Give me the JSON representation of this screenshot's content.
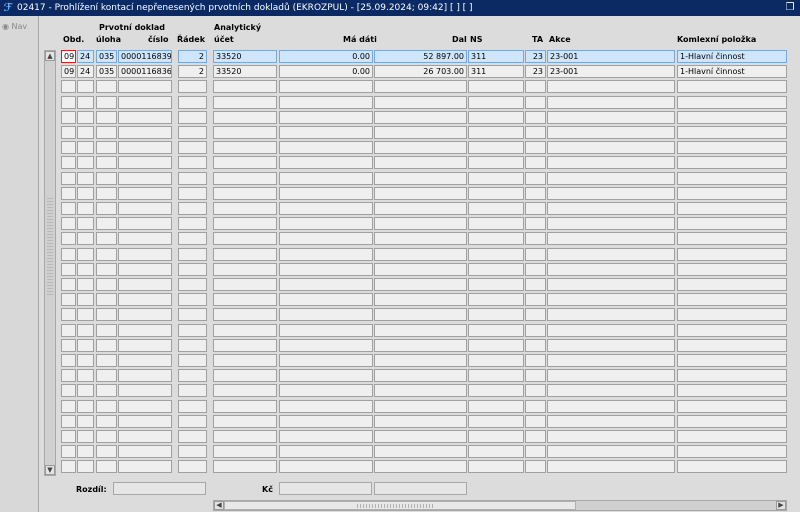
{
  "window": {
    "title": "02417 - Prohlížení kontací nepřenesených prvotních dokladů (EKROZPUL) - [25.09.2024; 09:42]  [ ]  [ ]",
    "logo_icon": "app-logo-icon",
    "restore_icon": "restore-window-icon"
  },
  "sidebar": {
    "nav_label": "Nav"
  },
  "headers": {
    "obd": "Obd.",
    "prvotni_doklad": "Prvotní doklad",
    "uloha": "úloha",
    "cislo": "číslo",
    "radek": "Řádek",
    "analyticky": "Analytický",
    "ucet": "účet",
    "ma_dati": "Má dáti",
    "dal": "Dal",
    "ns": "NS",
    "ta": "TA",
    "akce": "Akce",
    "komplexni_polozka": "Komlexní položka"
  },
  "rows": [
    {
      "obd_m": "09",
      "obd_y": "24",
      "uloha": "035",
      "cislo": "0000116839",
      "radek": "2",
      "ucet": "33520",
      "ma_dati": "0.00",
      "dal": "52 897.00",
      "ns": "311",
      "ta": "23",
      "akce": "23-001",
      "polozka": "1-Hlavní činnost"
    },
    {
      "obd_m": "09",
      "obd_y": "24",
      "uloha": "035",
      "cislo": "0000116836",
      "radek": "2",
      "ucet": "33520",
      "ma_dati": "0.00",
      "dal": "26 703.00",
      "ns": "311",
      "ta": "23",
      "akce": "23-001",
      "polozka": "1-Hlavní činnost"
    }
  ],
  "footer": {
    "rozdil_label": "Rozdíl:",
    "kc_label": "Kč"
  }
}
